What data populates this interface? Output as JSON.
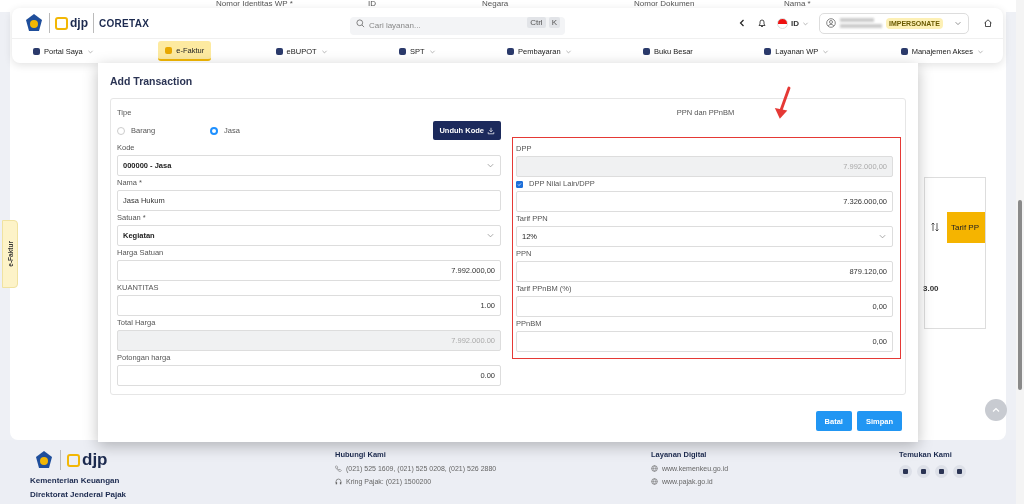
{
  "background_table": {
    "columns": [
      "Nomor Identitas WP *",
      "ID",
      "Negara",
      "Nomor Dokumen",
      "Nama *"
    ],
    "side_header": "Tarif PP",
    "side_value": "3.00"
  },
  "header": {
    "logo_text": "djp",
    "product": "CORETAX",
    "search": {
      "placeholder": "Cari layanan...",
      "keys": [
        "Ctrl",
        "K"
      ]
    },
    "language": "ID",
    "user_badge": "IMPERSONATE",
    "nav": [
      {
        "label": "Portal Saya",
        "has_menu": true,
        "selected": false
      },
      {
        "label": "e-Faktur",
        "has_menu": false,
        "selected": true
      },
      {
        "label": "eBUPOT",
        "has_menu": true,
        "selected": false
      },
      {
        "label": "SPT",
        "has_menu": true,
        "selected": false
      },
      {
        "label": "Pembayaran",
        "has_menu": true,
        "selected": false
      },
      {
        "label": "Buku Besar",
        "has_menu": false,
        "selected": false
      },
      {
        "label": "Layanan WP",
        "has_menu": true,
        "selected": false
      },
      {
        "label": "Manajemen Akses",
        "has_menu": true,
        "selected": false
      }
    ]
  },
  "side_tab": "e-Faktur",
  "modal": {
    "title": "Add Transaction",
    "type_label": "Tipe",
    "type_options": [
      {
        "label": "Barang",
        "selected": false
      },
      {
        "label": "Jasa",
        "selected": true
      }
    ],
    "download_button": "Unduh Kode",
    "fields": [
      {
        "kind": "select",
        "label": "Kode",
        "value": "000000 - Jasa",
        "disabled": false
      },
      {
        "kind": "text",
        "label": "Nama *",
        "value": "Jasa Hukum",
        "disabled": false
      },
      {
        "kind": "select",
        "label": "Satuan *",
        "value": "Kegiatan",
        "disabled": false
      },
      {
        "kind": "number",
        "label": "Harga Satuan",
        "value": "7.992.000,00",
        "disabled": false
      },
      {
        "kind": "number",
        "label": "KUANTITAS",
        "value": "1.00",
        "disabled": false
      },
      {
        "kind": "number",
        "label": "Total Harga",
        "value": "7.992.000.00",
        "disabled": true
      },
      {
        "kind": "number",
        "label": "Potongan harga",
        "value": "0.00",
        "disabled": false
      }
    ],
    "tax_title": "PPN dan PPnBM",
    "tax_fields": [
      {
        "kind": "number",
        "label": "DPP",
        "value": "7.992.000,00",
        "disabled": true
      },
      {
        "kind": "checkbox",
        "label": "DPP Nilai Lain/DPP",
        "checked": true,
        "value": "7.326.000,00",
        "disabled": false
      },
      {
        "kind": "select",
        "label": "Tarif PPN",
        "value": "12%",
        "disabled": false
      },
      {
        "kind": "number",
        "label": "PPN",
        "value": "879.120,00",
        "disabled": false
      },
      {
        "kind": "number",
        "label": "Tarif PPnBM (%)",
        "value": "0,00",
        "disabled": false
      },
      {
        "kind": "number",
        "label": "PPnBM",
        "value": "0,00",
        "disabled": false
      }
    ],
    "buttons": [
      {
        "label": "Batal"
      },
      {
        "label": "Simpan"
      }
    ]
  },
  "footer": {
    "org": [
      "Kementerian Keuangan",
      "Direktorat Jenderal Pajak"
    ],
    "logo_text": "djp",
    "columns": [
      {
        "title": "Hubungi Kami",
        "items": [
          {
            "kind": "phone",
            "text": "(021) 525 1609, (021) 525 0208, (021) 526 2880"
          },
          {
            "kind": "headset",
            "text": "Kring Pajak: (021) 1500200"
          }
        ]
      },
      {
        "title": "Layanan Digital",
        "items": [
          {
            "kind": "globe",
            "text": "www.kemenkeu.go.id"
          },
          {
            "kind": "globe",
            "text": "www.pajak.go.id"
          }
        ]
      }
    ],
    "social_title": "Temukan Kami"
  }
}
